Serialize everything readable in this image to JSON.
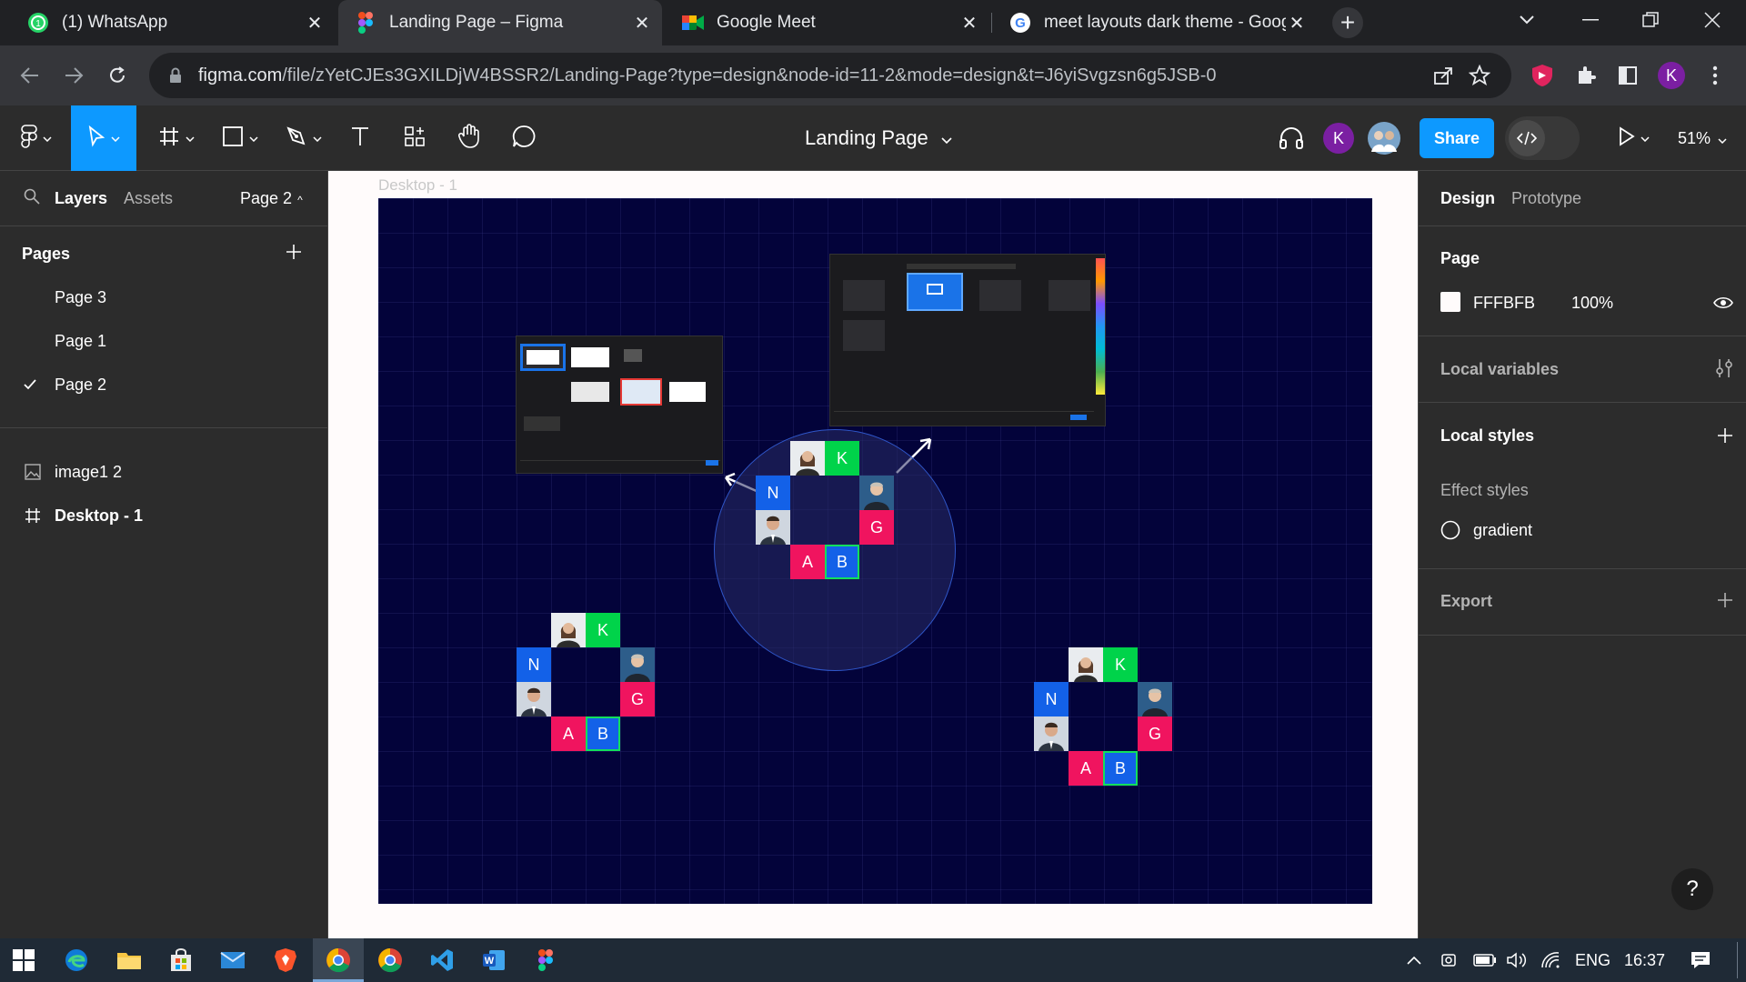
{
  "browser": {
    "tabs": [
      {
        "title": "(1) WhatsApp",
        "icon": "whatsapp-icon"
      },
      {
        "title": "Landing Page – Figma",
        "icon": "figma-icon"
      },
      {
        "title": "Google Meet",
        "icon": "google-meet-icon"
      },
      {
        "title": "meet layouts dark theme - Goog",
        "icon": "google-icon"
      }
    ],
    "url_host": "figma.com",
    "url_path": "/file/zYetCJEs3GXILDjW4BSSR2/Landing-Page?type=design&node-id=11-2&mode=design&t=J6yiSvgzsn6g5JSB-0",
    "profile_initial": "K"
  },
  "figma": {
    "doc_title": "Landing Page",
    "share_label": "Share",
    "zoom": "51%",
    "collab_initial": "K"
  },
  "left_panel": {
    "tab_layers": "Layers",
    "tab_assets": "Assets",
    "current_page": "Page 2",
    "pages_heading": "Pages",
    "pages": [
      "Page 3",
      "Page 1",
      "Page 2"
    ],
    "layers": [
      {
        "name": "image1 2",
        "icon": "image-icon"
      },
      {
        "name": "Desktop - 1",
        "icon": "frame-icon"
      }
    ]
  },
  "canvas": {
    "frame_label": "Desktop - 1",
    "frame_color": "#03033a",
    "tile_letters": {
      "k": "K",
      "n": "N",
      "g": "G",
      "a": "A",
      "b": "B"
    }
  },
  "right_panel": {
    "tab_design": "Design",
    "tab_prototype": "Prototype",
    "page_heading": "Page",
    "page_color": "FFFBFB",
    "page_opacity": "100%",
    "local_variables": "Local variables",
    "local_styles": "Local styles",
    "effect_styles": "Effect styles",
    "effect_name": "gradient",
    "export": "Export",
    "help": "?"
  },
  "taskbar": {
    "lang": "ENG",
    "time": "16:37"
  }
}
